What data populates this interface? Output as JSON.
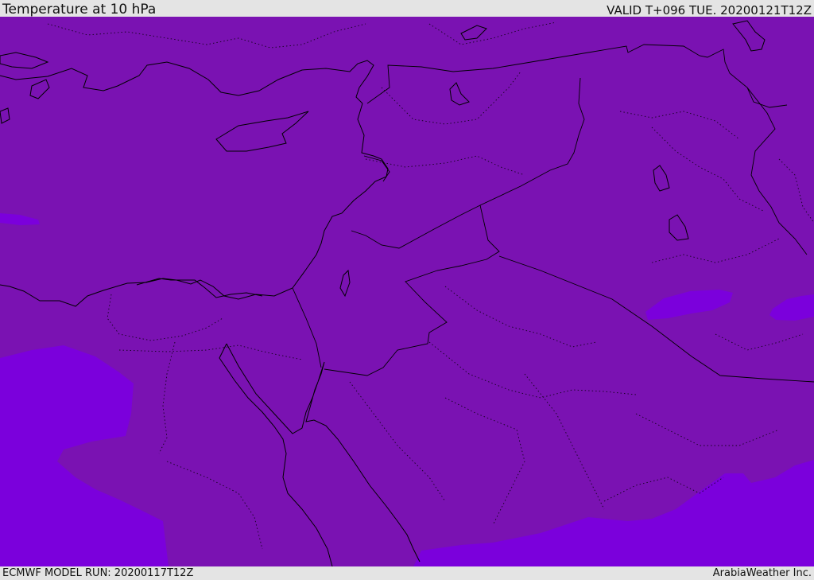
{
  "header": {
    "title": "Temperature at 10 hPa",
    "valid_time": "VALID T+096 TUE. 20200121T12Z"
  },
  "footer": {
    "model_run": "ECMWF MODEL RUN: 20200117T12Z",
    "credit": "ArabiaWeather Inc."
  },
  "colors": {
    "base_field": "#7a12b2",
    "cold_field": "#7b00dc"
  }
}
